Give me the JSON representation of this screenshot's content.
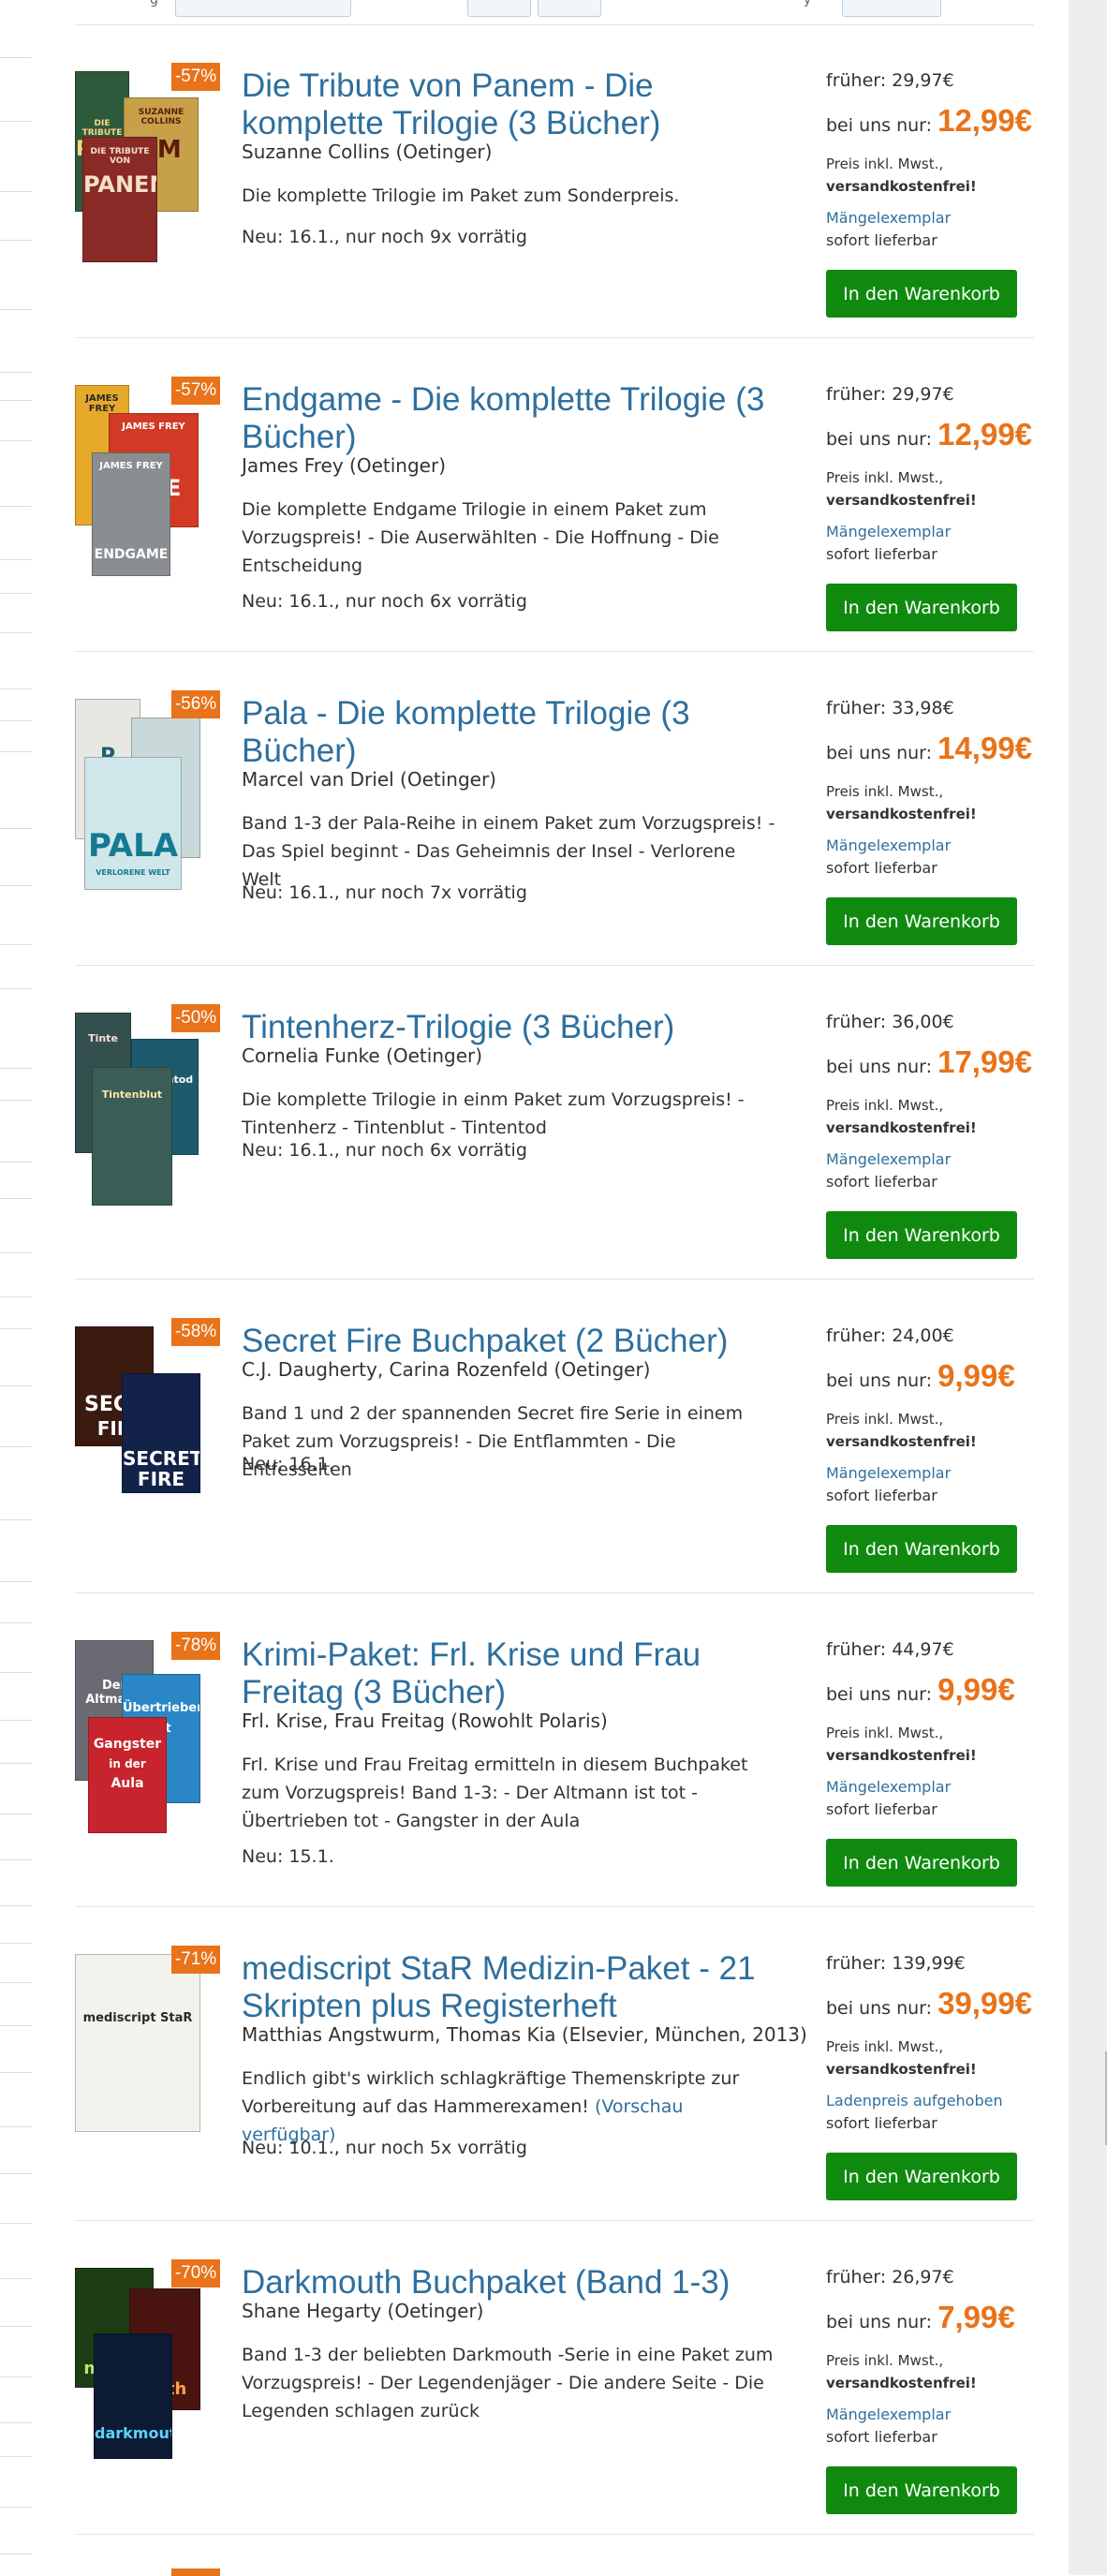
{
  "filters": {
    "box_1": "",
    "box_2": "",
    "box_3": "",
    "box_4": ""
  },
  "labels": {
    "earlier_prefix": "früher: ",
    "our_price_prefix": "bei uns nur: ",
    "tax_line": "Preis inkl. Mwst.,",
    "free_shipping": "versandkostenfrei!",
    "delivery": "sofort lieferbar",
    "add_to_cart": "In den Warenkorb"
  },
  "products": [
    {
      "badge": "-57%",
      "title": "Die Tribute von Panem - Die komplette Trilogie (3 Bücher)",
      "author": "Suzanne Collins (Oetinger)",
      "description": "Die komplette Trilogie im Paket zum Sonderpreis.",
      "preview_link": "",
      "availability": "Neu: 16.1., nur noch 9x vorrätig",
      "old_price": "29,97€",
      "price": "12,99€",
      "condition": "Mängelexemplar",
      "cover_texts": [
        "DIE TRIBUTE VON PANEM",
        "PANEM",
        "SUZANNE COLLINS",
        "EM",
        "DIE TRIBUTE VON",
        "PANEM"
      ]
    },
    {
      "badge": "-57%",
      "title": "Endgame - Die komplette Trilogie (3 Bücher)",
      "author": "James Frey (Oetinger)",
      "description": "Die komplette Endgame Trilogie in einem Paket zum Vorzugspreis! - Die Auserwählten - Die Hoffnung - Die Entscheidung",
      "preview_link": "",
      "availability": "Neu: 16.1., nur noch 6x vorrätig",
      "old_price": "29,97€",
      "price": "12,99€",
      "condition": "Mängelexemplar",
      "cover_texts": [
        "JAMES FREY",
        "E",
        "JAMES FREY",
        "AME",
        "JAMES FREY",
        "ENDGAME"
      ]
    },
    {
      "badge": "-56%",
      "title": "Pala - Die komplette Trilogie (3 Bücher)",
      "author": "Marcel van Driel (Oetinger)",
      "description": "Band 1-3 der Pala-Reihe in einem Paket zum Vorzugspreis! - Das Spiel beginnt - Das Geheimnis der Insel - Verlorene Welt",
      "preview_link": "",
      "availability": "Neu: 16.1., nur noch 7x vorrätig",
      "old_price": "33,98€",
      "price": "14,99€",
      "condition": "Mängelexemplar",
      "cover_texts": [
        "P",
        "A",
        "PALA",
        "VERLORENE WELT"
      ]
    },
    {
      "badge": "-50%",
      "title": "Tintenherz-Trilogie (3 Bücher)",
      "author": "Cornelia Funke (Oetinger)",
      "description": "Die komplette Trilogie in einm Paket zum Vorzugspreis! - Tintenherz - Tintenblut - Tintentod",
      "preview_link": "",
      "availability": "Neu: 16.1., nur noch 6x vorrätig",
      "old_price": "36,00€",
      "price": "17,99€",
      "condition": "Mängelexemplar",
      "cover_texts": [
        "Tinte",
        "Tintentod",
        "Tintenblut"
      ]
    },
    {
      "badge": "-58%",
      "title": "Secret Fire Buchpaket (2 Bücher)",
      "author": "C.J. Daugherty, Carina Rozenfeld (Oetinger)",
      "description": "Band 1 und 2 der spannenden Secret fire Serie in einem Paket zum Vorzugspreis! - Die Entflammten - Die Entfesselten",
      "preview_link": "",
      "availability": "Neu: 16.1.",
      "old_price": "24,00€",
      "price": "9,99€",
      "condition": "Mängelexemplar",
      "cover_texts": [
        "SECR",
        "FIR",
        "SECRET",
        "FIRE"
      ]
    },
    {
      "badge": "-78%",
      "title": "Krimi-Paket: Frl. Krise und Frau Freitag (3 Bücher)",
      "author": "Frl. Krise, Frau Freitag (Rowohlt Polaris)",
      "description": "Frl. Krise und Frau Freitag ermitteln in diesem Buchpaket zum Vorzugspreis! Band 1-3: - Der Altmann ist tot - Übertrieben tot - Gangster in der Aula",
      "preview_link": "",
      "availability": "Neu: 15.1.",
      "old_price": "44,97€",
      "price": "9,99€",
      "condition": "Mängelexemplar",
      "cover_texts": [
        "Der Altmann",
        "Übertrieben",
        "tot",
        "Gangster",
        "in der",
        "Aula"
      ]
    },
    {
      "badge": "-71%",
      "title": "mediscript StaR Medizin-Paket - 21 Skripten plus Registerheft",
      "author": "Matthias Angstwurm, Thomas Kia (Elsevier, München, 2013)",
      "description": "Endlich gibt's wirklich schlagkräftige Themenskripte zur Vorbereitung auf das Hammerexamen! ",
      "preview_link": "(Vorschau verfügbar)",
      "availability": "Neu: 10.1., nur noch 5x vorrätig",
      "old_price": "139,99€",
      "price": "39,99€",
      "condition": "Ladenpreis aufgehoben",
      "cover_texts": [
        "mediscript StaR"
      ]
    },
    {
      "badge": "-70%",
      "title": "Darkmouth Buchpaket (Band 1-3)",
      "author": "Shane Hegarty (Oetinger)",
      "description": "Band 1-3 der beliebten Darkmouth -Serie in eine Paket zum Vorzugspreis! - Der Legendenjäger - Die andere Seite - Die Legenden schlagen zurück",
      "preview_link": "",
      "availability": "",
      "old_price": "26,97€",
      "price": "7,99€",
      "condition": "Mängelexemplar",
      "cover_texts": [
        "mouth",
        "outh",
        "darkmouth"
      ]
    }
  ]
}
